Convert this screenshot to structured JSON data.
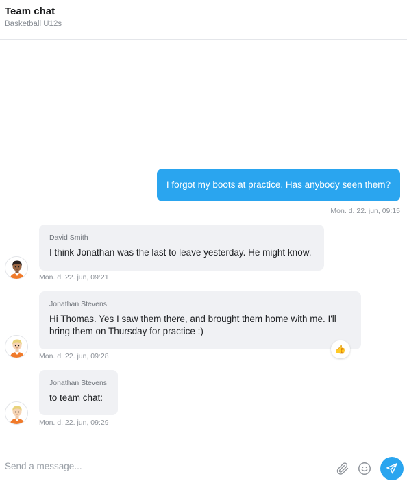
{
  "header": {
    "title": "Team chat",
    "subtitle": "Basketball U12s"
  },
  "messages": [
    {
      "direction": "outgoing",
      "text": "I forgot my boots at practice. Has anybody seen them?",
      "time": "Mon. d. 22. jun, 09:15"
    },
    {
      "direction": "incoming",
      "sender": "David Smith",
      "text": "I think Jonathan was the last to leave yesterday. He might know.",
      "time": "Mon. d. 22. jun, 09:21",
      "avatar": "avatar-dark-hair"
    },
    {
      "direction": "incoming",
      "sender": "Jonathan Stevens",
      "text_lines": [
        "Hi Thomas. Yes I saw them there, and brought them home with me. I'll",
        "bring them on Thursday for practice :)"
      ],
      "time": "Mon. d. 22. jun, 09:28",
      "avatar": "avatar-blond-hair",
      "reaction": "👍"
    },
    {
      "direction": "incoming",
      "sender": "Jonathan Stevens",
      "text": "to team chat:",
      "time": "Mon. d. 22. jun, 09:29",
      "avatar": "avatar-blond-hair"
    }
  ],
  "composer": {
    "placeholder": "Send a message...",
    "attach_icon": "paperclip-icon",
    "emoji_icon": "smiley-icon",
    "send_icon": "send-icon"
  },
  "colors": {
    "accent": "#2aa5ef",
    "incoming_bubble": "#f0f1f4",
    "jersey": "#f07a2a"
  }
}
